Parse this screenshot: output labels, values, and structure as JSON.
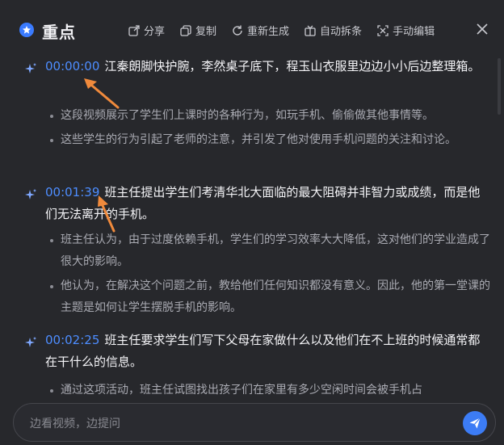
{
  "header": {
    "title": "重点",
    "icon": "star-icon",
    "toolbar": [
      {
        "label": "分享",
        "icon": "share-icon"
      },
      {
        "label": "复制",
        "icon": "copy-icon"
      },
      {
        "label": "重新生成",
        "icon": "refresh-icon"
      },
      {
        "label": "自动拆条",
        "icon": "split-icon"
      },
      {
        "label": "手动编辑",
        "icon": "edit-icon"
      }
    ],
    "close_icon": "close-icon"
  },
  "sections": [
    {
      "timestamp": "00:00:00",
      "headline": "江秦朗脚快护腕，李然桌子底下，程玉山衣服里边边小小后边整理箱。",
      "bullets": [
        "这段视频展示了学生们上课时的各种行为，如玩手机、偷偷做其他事情等。",
        "这些学生的行为引起了老师的注意，并引发了他对使用手机问题的关注和讨论。"
      ]
    },
    {
      "timestamp": "00:01:39",
      "headline": "班主任提出学生们考清华北大面临的最大阻碍并非智力或成绩，而是他们无法离开的手机。",
      "bullets": [
        "班主任认为，由于过度依赖手机，学生们的学习效率大大降低，这对他们的学业造成了很大的影响。",
        "他认为，在解决这个问题之前，教给他们任何知识都没有意义。因此，他的第一堂课的主题是如何让学生摆脱手机的影响。"
      ]
    },
    {
      "timestamp": "00:02:25",
      "headline": "班主任要求学生们写下父母在家做什么以及他们在不上班的时候通常都在干什么的信息。",
      "bullets": [
        "通过这项活动，班主任试图找出孩子们在家里有多少空闲时间会被手机占"
      ]
    }
  ],
  "input": {
    "placeholder": "边看视频，边提问",
    "send_icon": "send-icon"
  },
  "colors": {
    "background": "#27282c",
    "timestamp": "#4d8dff",
    "accent": "#3c7cf5",
    "annotation_arrow": "#f08a3c"
  }
}
